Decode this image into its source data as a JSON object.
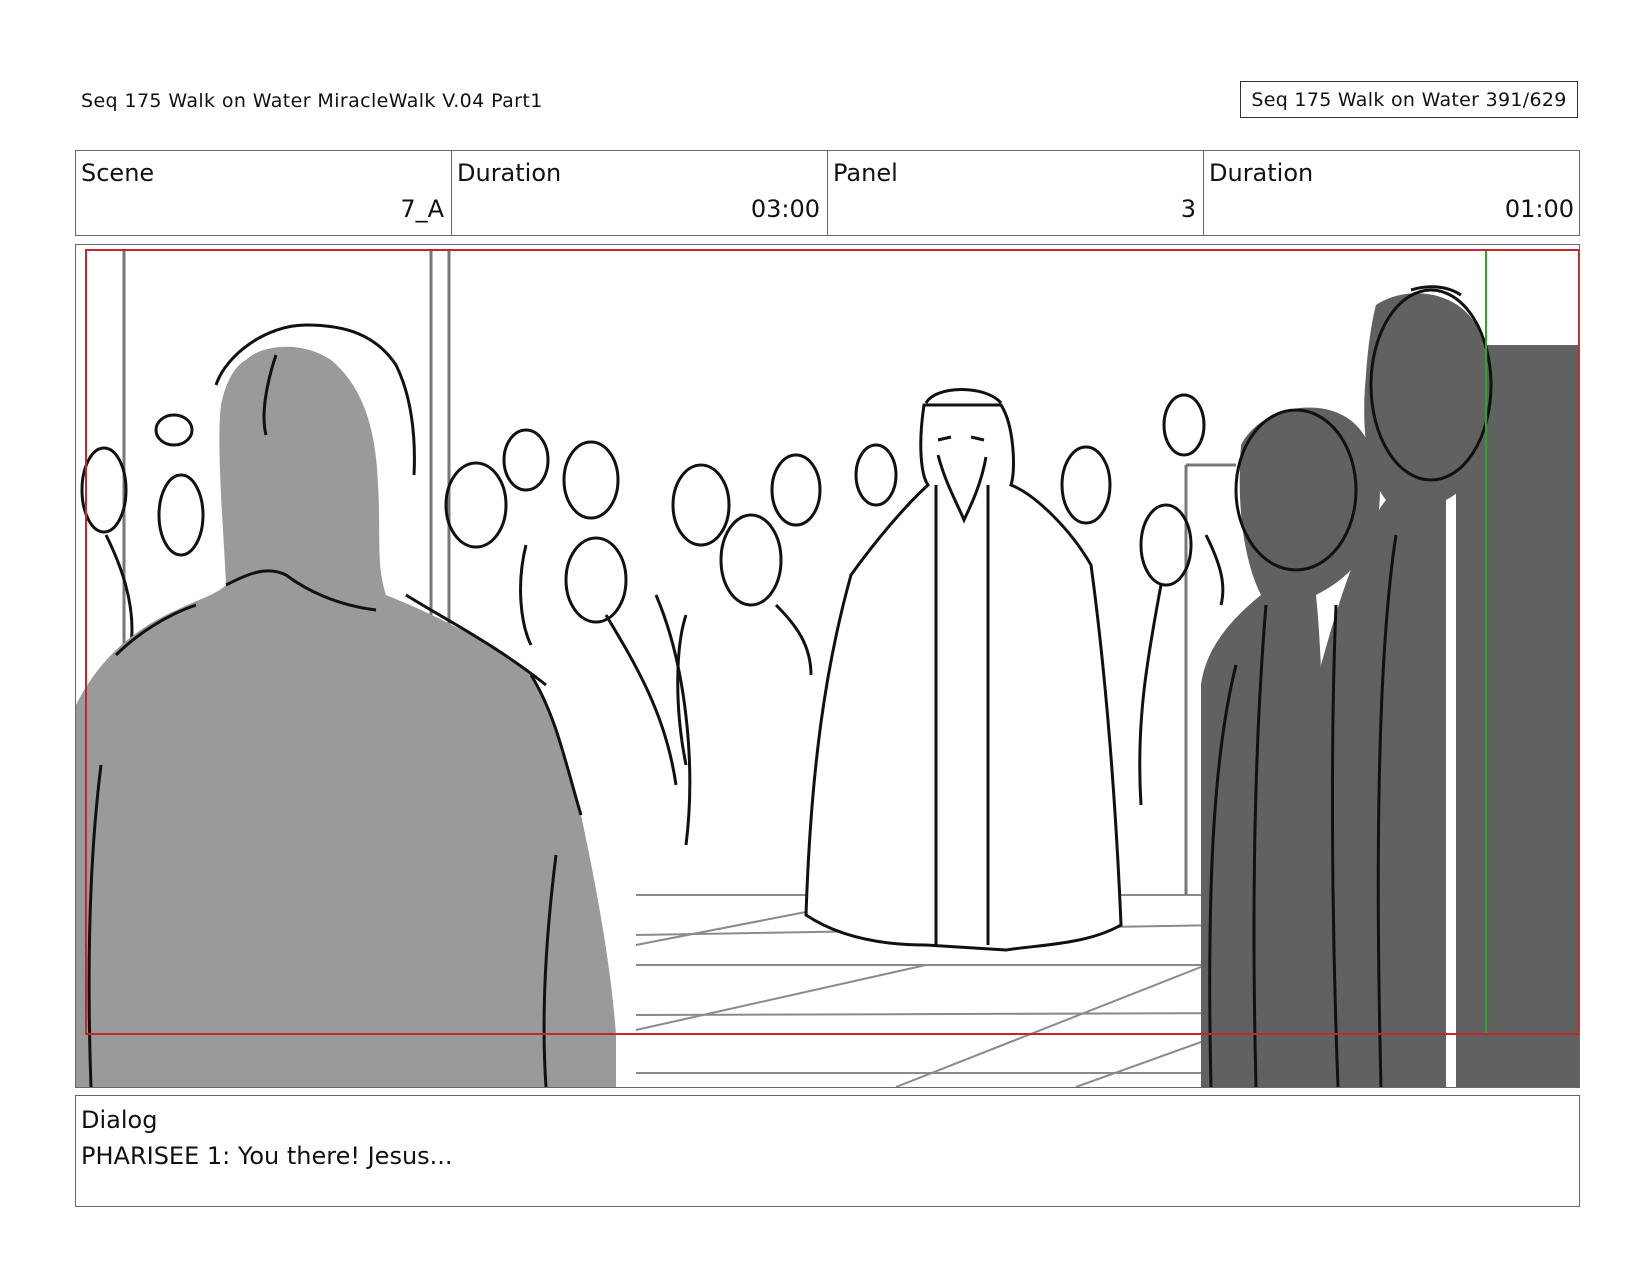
{
  "header": {
    "title": "Seq 175 Walk on Water  MiracleWalk V.04 Part1",
    "page_counter": "Seq 175 Walk on Water 391/629"
  },
  "info": {
    "scene_label": "Scene",
    "scene_value": "7_A",
    "scene_duration_label": "Duration",
    "scene_duration_value": "03:00",
    "panel_label": "Panel",
    "panel_value": "3",
    "panel_duration_label": "Duration",
    "panel_duration_value": "01:00"
  },
  "dialog": {
    "label": "Dialog",
    "text": "PHARISEE 1: You there! Jesus..."
  },
  "colors": {
    "safe_frame_green": "#2aa52a",
    "action_frame_red": "#c0282d",
    "light_figure_fill": "#9a9a9a",
    "dark_figure_fill": "#616161",
    "line_black": "#111111"
  }
}
